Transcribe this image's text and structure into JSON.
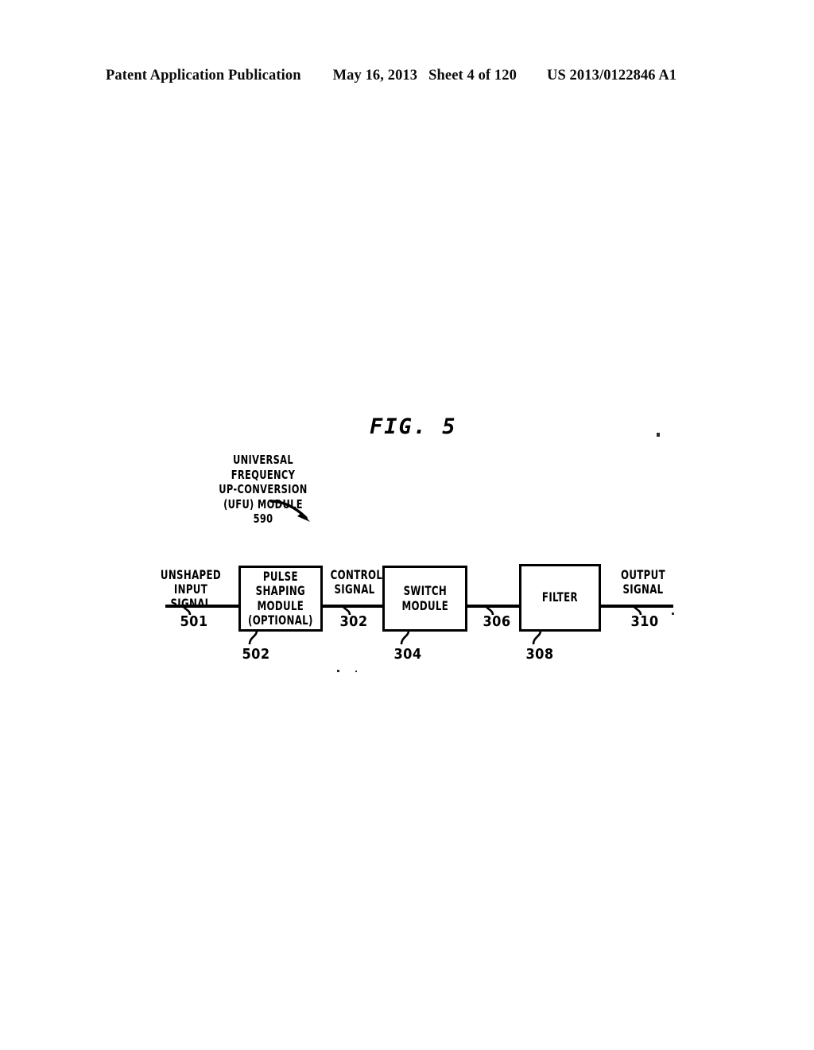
{
  "header": {
    "publication": "Patent Application Publication",
    "date": "May 16, 2013",
    "sheet": "Sheet 4 of 120",
    "number": "US 2013/0122846 A1"
  },
  "figure": {
    "label": "FIG. 5",
    "caption": {
      "line1": "UNIVERSAL FREQUENCY",
      "line2": "UP-CONVERSION",
      "line3": "(UFU) MODULE",
      "line4": "590"
    }
  },
  "diagram": {
    "blocks": [
      {
        "id": "pulse-shaping-module",
        "line1": "PULSE",
        "line2": "SHAPING",
        "line3": "MODULE",
        "line4": "(OPTIONAL)",
        "ref": "502"
      },
      {
        "id": "switch-module",
        "line1": "SWITCH",
        "line2": "MODULE",
        "ref": "304"
      },
      {
        "id": "filter",
        "line1": "FILTER",
        "ref": "308"
      }
    ],
    "signals": [
      {
        "id": "unshaped-input-signal",
        "line1": "UNSHAPED INPUT",
        "line2": "SIGNAL",
        "ref": "501"
      },
      {
        "id": "control-signal",
        "line1": "CONTROL",
        "line2": "SIGNAL",
        "ref": "302"
      },
      {
        "id": "switch-filter-link",
        "ref": "306"
      },
      {
        "id": "output-signal",
        "line1": "OUTPUT",
        "line2": "SIGNAL",
        "ref": "310"
      }
    ]
  },
  "colors": {
    "ink": "#000000",
    "page": "#ffffff"
  }
}
